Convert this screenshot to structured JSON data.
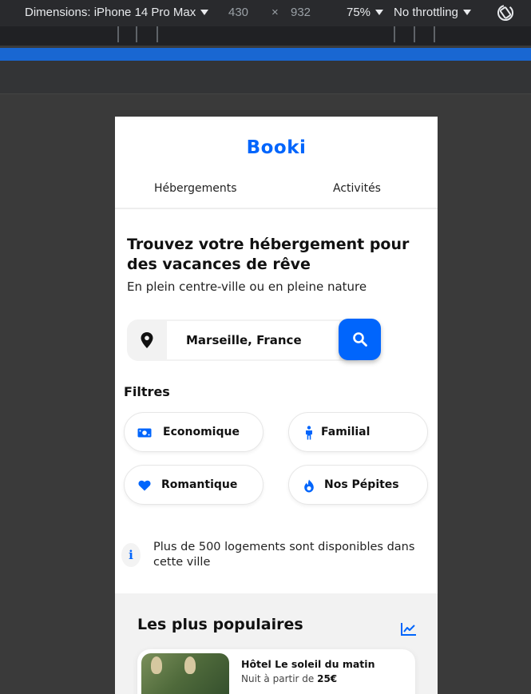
{
  "devtools": {
    "dimensions_label": "Dimensions: iPhone 14 Pro Max",
    "width": "430",
    "times": "×",
    "height": "932",
    "zoom": "75%",
    "throttling": "No throttling"
  },
  "app": {
    "logo": "Booki",
    "nav": [
      "Hébergements",
      "Activités"
    ],
    "headline": "Trouvez votre hébergement pour des vacances de rêve",
    "subline": "En plein centre-ville ou en pleine nature",
    "search": {
      "value": "Marseille, France"
    },
    "filters_title": "Filtres",
    "filters": [
      {
        "label": "Economique",
        "icon": "money-icon"
      },
      {
        "label": "Familial",
        "icon": "child-icon"
      },
      {
        "label": "Romantique",
        "icon": "heart-icon"
      },
      {
        "label": "Nos Pépites",
        "icon": "fire-icon"
      }
    ],
    "info_text": "Plus de 500 logements sont disponibles dans cette ville",
    "popular_title": "Les plus populaires",
    "card": {
      "name": "Hôtel Le soleil du matin",
      "price_prefix": "Nuit à partir de ",
      "price_value": "25€"
    },
    "accent": "#0065fc"
  }
}
